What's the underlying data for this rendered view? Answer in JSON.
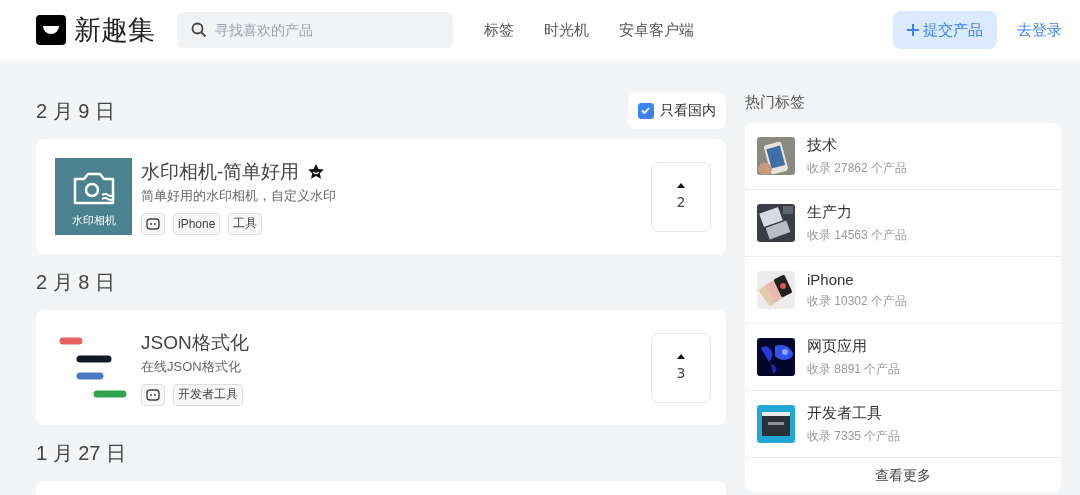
{
  "header": {
    "brand": "新趣集",
    "search": {
      "placeholder": "寻找喜欢的产品"
    },
    "nav": [
      "标签",
      "时光机",
      "安卓客户端"
    ],
    "submit_button": "提交产品",
    "login_link": "去登录"
  },
  "filter": {
    "label": "只看国内",
    "checked": true
  },
  "days": [
    {
      "date": "2 月 9 日",
      "products": [
        {
          "name": "水印相机-简单好用",
          "featured": true,
          "description": "简单好用的水印相机，自定义水印",
          "logo": {
            "kind": "camera",
            "text": "水印相机"
          },
          "tags": [
            {
              "kind": "icon"
            },
            {
              "kind": "text",
              "label": "iPhone"
            },
            {
              "kind": "text",
              "label": "工具"
            }
          ],
          "votes": "2"
        }
      ]
    },
    {
      "date": "2 月 8 日",
      "products": [
        {
          "name": "JSON格式化",
          "featured": false,
          "description": "在线JSON格式化",
          "logo": {
            "kind": "bars"
          },
          "tags": [
            {
              "kind": "icon"
            },
            {
              "kind": "text",
              "label": "开发者工具"
            }
          ],
          "votes": "3"
        }
      ]
    },
    {
      "date": "1 月 27 日"
    }
  ],
  "sidebar": {
    "title": "热门标签",
    "tags": [
      {
        "name": "技术",
        "count": "收录 27862 个产品",
        "kind": "picture"
      },
      {
        "name": "生产力",
        "count": "收录 14563 个产品",
        "kind": "picture"
      },
      {
        "name": "iPhone",
        "count": "收录 10302 个产品",
        "kind": "picture"
      },
      {
        "name": "网页应用",
        "count": "收录 8891 个产品",
        "kind": "picture"
      },
      {
        "name": "开发者工具",
        "count": "收录 7335 个产品",
        "kind": "picture"
      }
    ],
    "more": "查看更多"
  }
}
